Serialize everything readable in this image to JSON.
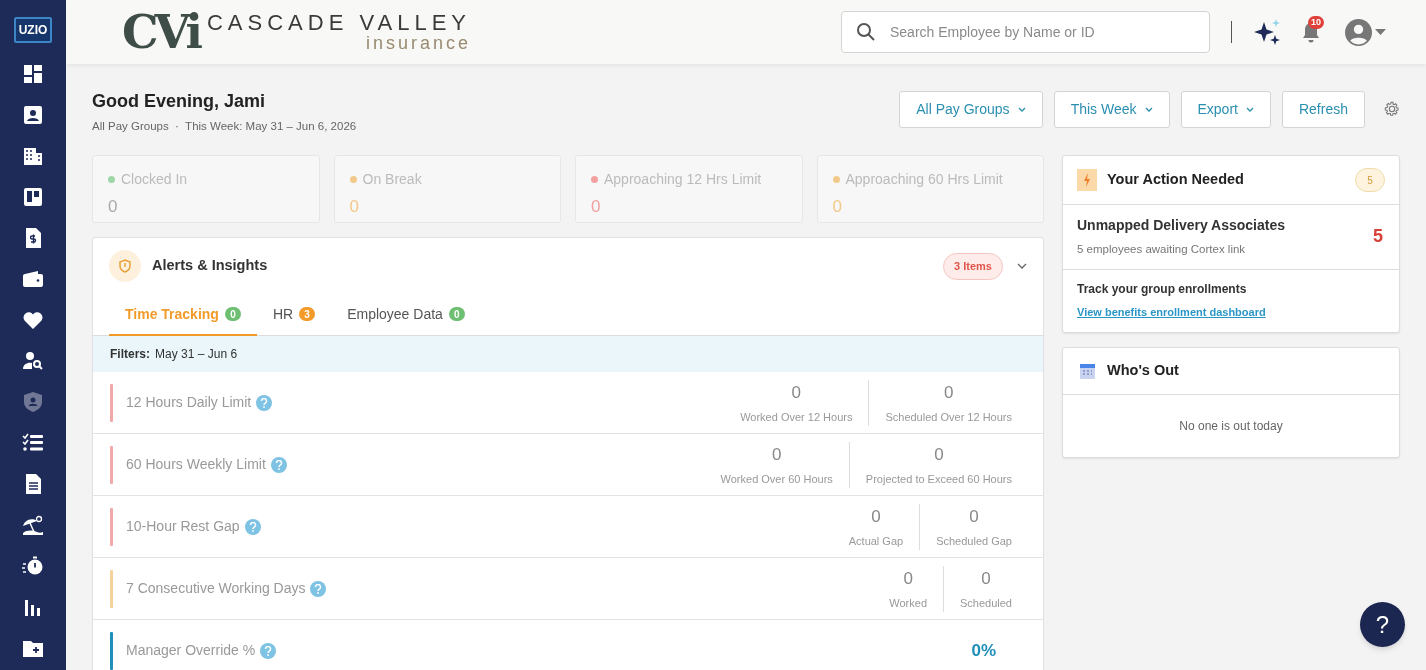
{
  "sidebar": {
    "logo": "UZIO",
    "items": [
      {
        "disabled": false
      },
      {
        "disabled": false
      },
      {
        "disabled": false
      },
      {
        "disabled": false
      },
      {
        "disabled": false
      },
      {
        "disabled": false
      },
      {
        "disabled": false
      },
      {
        "disabled": false
      },
      {
        "disabled": true
      },
      {
        "disabled": false
      },
      {
        "disabled": false
      },
      {
        "disabled": false
      },
      {
        "disabled": false
      },
      {
        "disabled": false
      },
      {
        "disabled": false
      }
    ]
  },
  "header": {
    "logo_mark": "CVi",
    "logo_name": "CASCADE VALLEY",
    "logo_sub": "insurance",
    "search": {
      "placeholder": "Search Employee by Name or ID"
    },
    "notifications": "10"
  },
  "greeting": {
    "title": "Good Evening, Jami",
    "subtitle": "All Pay Groups  ·  This Week: May 31 – Jun 6, 2026"
  },
  "toolbar": [
    {
      "label": "All Pay Groups",
      "dropdown": true
    },
    {
      "label": "This Week",
      "dropdown": true
    },
    {
      "label": "Export",
      "dropdown": true
    },
    {
      "label": "Refresh",
      "dropdown": false
    }
  ],
  "stats": [
    {
      "label": "Clocked In",
      "value": "0",
      "color": "#9fd6a8"
    },
    {
      "label": "On Break",
      "value": "0",
      "color": "#f2c98a"
    },
    {
      "label": "Approaching 12 Hrs Limit",
      "value": "0",
      "color": "#f2a0a0"
    },
    {
      "label": "Approaching 60 Hrs Limit",
      "value": "0",
      "color": "#f2c98a"
    }
  ],
  "alerts": {
    "title": "Alerts & Insights",
    "badge": "3 Items",
    "tabs": [
      {
        "label": "Time Tracking",
        "count": "0",
        "color": "#6fbf73",
        "selected": true
      },
      {
        "label": "HR",
        "count": "3",
        "color": "#f29b2a",
        "selected": false
      },
      {
        "label": "Employee Data",
        "count": "0",
        "color": "#6fbf73",
        "selected": false
      }
    ],
    "filter_label": "Filters:",
    "filter_value": "May 31 – Jun 6",
    "rows": [
      {
        "title": "12 Hours Daily Limit",
        "color": "#f0a8a8",
        "metrics": [
          {
            "value": "0",
            "label": "Worked Over 12 Hours"
          },
          {
            "value": "0",
            "label": "Scheduled Over 12 Hours"
          }
        ]
      },
      {
        "title": "60 Hours Weekly Limit",
        "color": "#f0a8a8",
        "metrics": [
          {
            "value": "0",
            "label": "Worked Over 60 Hours"
          },
          {
            "value": "0",
            "label": "Projected to Exceed 60 Hours"
          }
        ]
      },
      {
        "title": "10-Hour Rest Gap",
        "color": "#f0a8a8",
        "metrics": [
          {
            "value": "0",
            "label": "Actual Gap"
          },
          {
            "value": "0",
            "label": "Scheduled Gap"
          }
        ]
      },
      {
        "title": "7 Consecutive Working Days",
        "color": "#f5d29a",
        "metrics": [
          {
            "value": "0",
            "label": "Worked"
          },
          {
            "value": "0",
            "label": "Scheduled"
          }
        ]
      },
      {
        "title": "Manager Override %",
        "color": "#1f8fb8",
        "metrics": [
          {
            "value": "0%"
          }
        ]
      }
    ]
  },
  "action_needed": {
    "title": "Your Action Needed",
    "count": "5",
    "items": [
      {
        "kind": "count",
        "title": "Unmapped Delivery Associates",
        "detail": "5 employees awaiting Cortex link",
        "count": "5"
      },
      {
        "kind": "link",
        "title": "Track your group enrollments",
        "link": "View benefits enrollment dashboard"
      }
    ]
  },
  "whos_out": {
    "title": "Who's Out",
    "empty": "No one is out today"
  },
  "help": "?"
}
